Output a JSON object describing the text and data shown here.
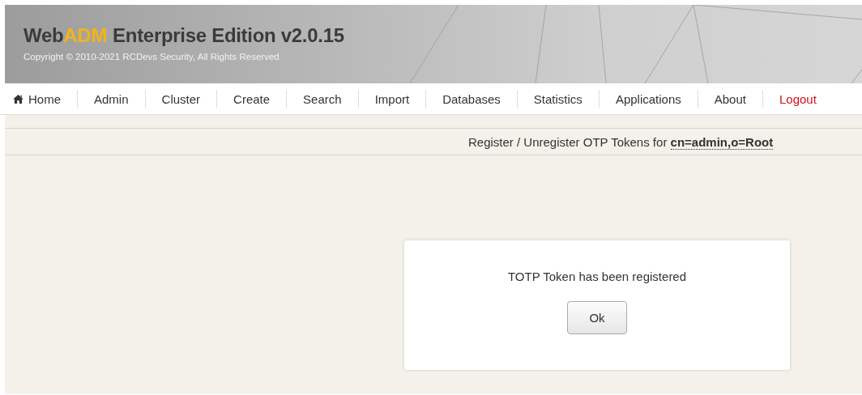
{
  "header": {
    "title": [
      {
        "text": "Web",
        "kind": "plain"
      },
      {
        "text": "ADM",
        "kind": "accent"
      },
      {
        "text": "Enterprise Edition v2.0.15",
        "kind": "plain"
      }
    ],
    "copyright": "Copyright © 2010-2021 RCDevs Security, All Rights Reserved"
  },
  "nav": [
    {
      "label": "Home",
      "kind": "home"
    },
    {
      "label": "Admin",
      "kind": "plain"
    },
    {
      "label": "Cluster",
      "kind": "plain"
    },
    {
      "label": "Create",
      "kind": "plain"
    },
    {
      "label": "Search",
      "kind": "plain"
    },
    {
      "label": "Import",
      "kind": "plain"
    },
    {
      "label": "Databases",
      "kind": "plain"
    },
    {
      "label": "Statistics",
      "kind": "plain"
    },
    {
      "label": "Applications",
      "kind": "plain"
    },
    {
      "label": "About",
      "kind": "plain"
    },
    {
      "label": "Logout",
      "kind": "logout"
    }
  ],
  "page_heading": {
    "text": "Register / Unregister OTP Tokens for",
    "link": "cn=admin,o=Root"
  },
  "dialog": {
    "message": "TOTP Token has been registered",
    "button": "Ok"
  }
}
